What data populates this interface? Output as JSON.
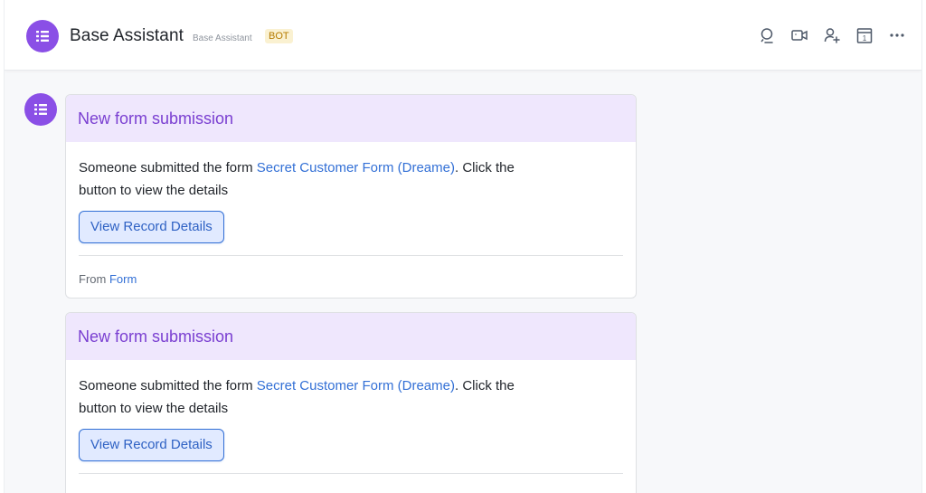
{
  "header": {
    "title": "Base Assistant",
    "subtitle": "Base Assistant",
    "badge": "BOT",
    "avatar_icon": "list-icon",
    "actions": [
      "search-chat-icon",
      "video-call-icon",
      "add-member-icon",
      "calendar-icon",
      "more-icon"
    ],
    "calendar_day": "1"
  },
  "colors": {
    "accent": "#8a4fe6",
    "card_header_bg": "#efe7fd",
    "card_title": "#7a3fd1",
    "link": "#3370d6",
    "badge_bg": "#faf1d1",
    "badge_text": "#b57b00"
  },
  "messages": [
    {
      "title": "New form submission",
      "text_before": "Someone submitted the form ",
      "form_link": "Secret Customer Form (Dreame)",
      "text_after": ". Click the button to view the details",
      "button_label": "View Record Details",
      "footer_prefix": "From ",
      "footer_link": "Form"
    },
    {
      "title": "New form submission",
      "text_before": "Someone submitted the form ",
      "form_link": "Secret Customer Form (Dreame)",
      "text_after": ". Click the button to view the details",
      "button_label": "View Record Details"
    }
  ]
}
